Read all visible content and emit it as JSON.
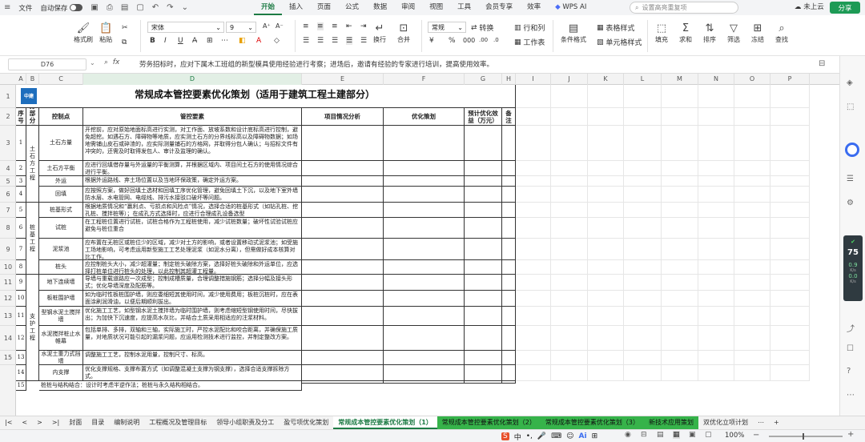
{
  "menubar": {
    "file": "文件",
    "autosave": "自动保存",
    "tabs": [
      "开始",
      "插入",
      "页面",
      "公式",
      "数据",
      "审阅",
      "视图",
      "工具",
      "会员专享",
      "效率"
    ],
    "wps_ai": "WPS AI",
    "search_placeholder": "设置高亮重复项",
    "cloud": "未上云",
    "share": "分享"
  },
  "ribbon": {
    "format_painter": "格式刷",
    "paste": "粘贴",
    "font_name": "宋体",
    "font_size": "9",
    "wrap": "换行",
    "merge": "合并",
    "number_format": "常规",
    "convert": "转换",
    "rows_cols": "行和列",
    "worksheet": "工作表",
    "cond_format": "条件格式",
    "table_style": "表格样式",
    "cell_style": "单元格样式",
    "fill": "填充",
    "sum": "求和",
    "sort": "排序",
    "filter": "筛选",
    "freeze": "冻结",
    "find": "查找"
  },
  "formula_bar": {
    "cell_ref": "D76",
    "fx": "fx",
    "content": "劳务招标时，应对下属木工班组的新型模具使用经验进行考察；进场后，邀请有经验的专家进行培训，提高使用效率。"
  },
  "columns": [
    "A",
    "B",
    "C",
    "D",
    "E",
    "F",
    "G",
    "H",
    "I",
    "J",
    "K",
    "L",
    "M",
    "N",
    "O",
    "P"
  ],
  "rows": [
    "1",
    "2",
    "3",
    "4",
    "5",
    "6",
    "7",
    "8",
    "9",
    "10",
    "11",
    "12",
    "13",
    "14",
    "15"
  ],
  "sheet": {
    "title": "常规成本管控要素优化策划（适用于建筑工程土建部分）",
    "logo_text": "中建",
    "headers": {
      "seq": "序号",
      "category": "分部分项",
      "control_point": "控制点",
      "elements": "管控要素",
      "analysis": "项目情况分析",
      "strategy": "优化策划",
      "benefit": "预计优化效益（万元）",
      "remark": "备注"
    },
    "groups": [
      {
        "name": "土石方工程"
      },
      {
        "name": "桩基工程"
      },
      {
        "name": "支护工程"
      }
    ],
    "items": [
      {
        "seq": "1",
        "point": "土石方量",
        "text": "开挖前，应对原始地面标高进行实测，对工作面、放坡系数和设计底标高进行控制，避免超挖。如遇石方、障碍物等地质，应实测土石方的分界线标高以及障碍物数据；如场地需铺山皮石或碎渣的，应实际测量铺石的方格网，并取得分包人确认；与招标文件有冲突的，还需及时取得发包人、审计及监理的确认。"
      },
      {
        "seq": "2",
        "point": "土石方平衡",
        "text": "应进行回填借存量与外运量的平衡测算，并根据区域内、项目间土石方的使用情况综合进行平衡。"
      },
      {
        "seq": "3",
        "point": "外运",
        "text": "根据外运路线、弃土场位置以及当地环保政策，确定外运方案。"
      },
      {
        "seq": "4",
        "point": "回填",
        "text": "应按照方案，做好回填土选材和回填工序优化管理，避免回填土下沉，以及地下室外墙防水层、水电管网、电缆线、排污水接驳口破坏等问题。"
      },
      {
        "seq": "5",
        "point": "桩基形式",
        "text": "根据地质情况和“赢利点、亏损点和风险点”情况，选择合适的桩基形式（如钻孔桩、挖孔桩、搅拌桩等）；在成孔方式选择时，应进行合理成孔设备选型"
      },
      {
        "seq": "6",
        "point": "试桩",
        "text": "在工程桩位置进行试桩，试桩合格作为工程桩使用，减少试桩数量；破坏性试验试桩应避免与桩位重合"
      },
      {
        "seq": "7",
        "point": "泥浆池",
        "text": "应布置在无桩区或桩位少的区域，减少对土方的影响，或者设置移动式泥浆池；如受施工场地影响，可考虑运用新型施工工艺处理泥浆（如泥水分离），但需做好成本核算对比工作。"
      },
      {
        "seq": "8",
        "point": "桩头",
        "text": "应控制桩头大小，减少超灌量；制定桩头破除方案，选择好桩头破除和外运单位，应选择打桩单位进行桩头的处理，以此控制其超灌工程量。"
      },
      {
        "seq": "9",
        "point": "地下连续墙",
        "text": "导墙与重载道路应一次成型；控制成槽质量，合理调整措施钢筋；选择分幅及接头形式；优化导墙深度及配筋等。"
      },
      {
        "seq": "10",
        "point": "板桩围护墙",
        "text": "如为临时性板桩围护墙，则应委细短其使用时间，减少使用费用；板桩沉桩时，应在表面涂刷润滑油，以便后期顺利拔出。"
      },
      {
        "seq": "11",
        "point": "型钢水泥土搅拌墙",
        "text": "优化施工工艺，如型钢水泥土搅拌墙为临时围护墙，则考虑缩短型钢使用时间，尽快拔出；为加快下沉速度，应提高水灰比，并结合土质采用相适应的注浆材料。"
      },
      {
        "seq": "12",
        "point": "水泥搅拌桩止水帷幕",
        "text": "包括单排、多排，双轴和三轴，实际施工时，严控水泥配比和咬合距离，并确保施工质量，对地质状况可能引起的漏浆问题，应运用检测技术进行监控，并制定整改方案。"
      },
      {
        "seq": "13",
        "point": "水泥土重力式挡墙",
        "text": "调整施工工艺，控制水泥用量，控制尺寸、标高。"
      },
      {
        "seq": "14",
        "point": "内支撑",
        "text": "优化支撑规格、支撑布置方式（如调整混凝土支撑为钢支撑），选择合适支撑拆除方式。"
      },
      {
        "seq": "15",
        "point": "",
        "text": "桩桩与结构结合：设计时考虑半逆作法；桩桩与永久结构相结合。"
      }
    ]
  },
  "sheet_tabs": [
    "封面",
    "目录",
    "编制说明",
    "工程概况及管理目标",
    "领导小组职责及分工",
    "盈亏项优化策划",
    "常规成本管控要素优化策划（1）",
    "常规成本管控要素优化策划（2）",
    "常规成本管控要素优化策划（3）",
    "新技术应用策划",
    "双优化立项计划"
  ],
  "status": {
    "zoom": "100%"
  },
  "side_perf": {
    "score": "75",
    "up": "0.9",
    "up_unit": "K/s",
    "down": "0.0",
    "down_unit": "K/s"
  },
  "colors": {
    "accent": "#1d7b44",
    "share": "#1d9a55",
    "tab_highlight": "#36b34a",
    "logo": "#1e6ebd"
  }
}
